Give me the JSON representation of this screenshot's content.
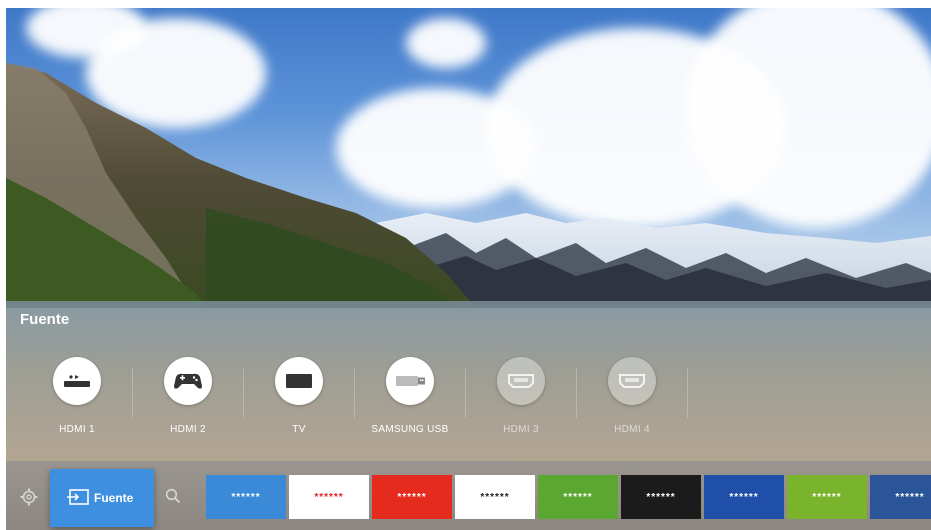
{
  "panel": {
    "title": "Fuente"
  },
  "sources": [
    {
      "label": "HDMI 1",
      "icon": "set-top-box-icon",
      "active": true
    },
    {
      "label": "HDMI 2",
      "icon": "game-controller-icon",
      "active": true
    },
    {
      "label": "TV",
      "icon": "tv-icon",
      "active": true
    },
    {
      "label": "SAMSUNG USB",
      "icon": "usb-drive-icon",
      "active": true
    },
    {
      "label": "HDMI 3",
      "icon": "hdmi-port-icon",
      "active": false
    },
    {
      "label": "HDMI 4",
      "icon": "hdmi-port-icon",
      "active": false
    }
  ],
  "bar": {
    "settings_icon": "gear-icon",
    "source_button": {
      "label": "Fuente",
      "icon": "source-input-icon"
    },
    "search_icon": "search-icon",
    "apps": [
      {
        "label": "******",
        "bg": "#3a8ad8",
        "fg": "#ffffff"
      },
      {
        "label": "******",
        "bg": "#ffffff",
        "fg": "#e02020"
      },
      {
        "label": "******",
        "bg": "#e52a1e",
        "fg": "#ffffff"
      },
      {
        "label": "******",
        "bg": "#ffffff",
        "fg": "#222222"
      },
      {
        "label": "******",
        "bg": "#5aa832",
        "fg": "#ffffff"
      },
      {
        "label": "******",
        "bg": "#1b1b1b",
        "fg": "#ffffff"
      },
      {
        "label": "******",
        "bg": "#1f4fa8",
        "fg": "#ffffff"
      },
      {
        "label": "******",
        "bg": "#7ab42c",
        "fg": "#ffffff"
      },
      {
        "label": "******",
        "bg": "#2a5598",
        "fg": "#ffffff"
      }
    ]
  }
}
